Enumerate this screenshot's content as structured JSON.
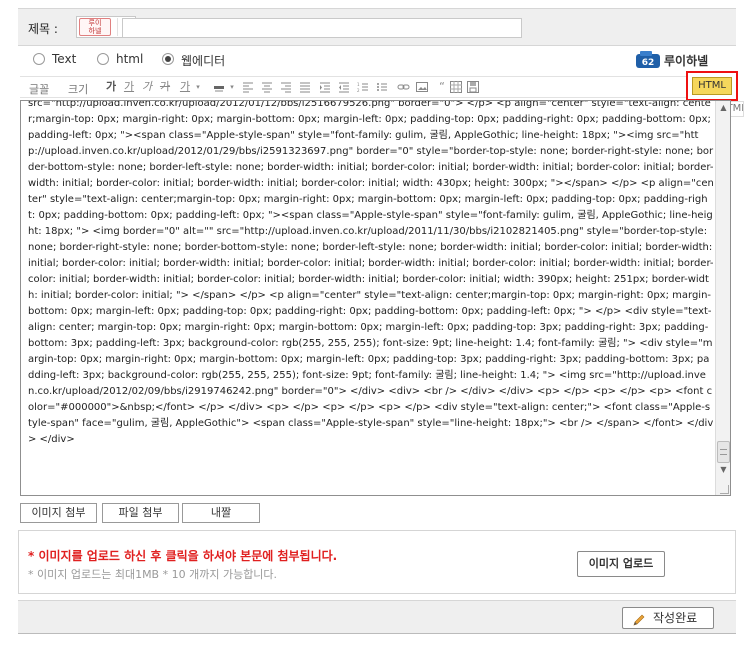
{
  "title_row": {
    "label": "제목 :",
    "emoticon_text": "루이\n하넬",
    "input_value": ""
  },
  "mode": {
    "options": [
      "Text",
      "html",
      "웹에디터"
    ],
    "selected": "웹에디터"
  },
  "site": {
    "badge_number": "62",
    "name": "루이하넬"
  },
  "toolbar": {
    "font_label": "글꼴",
    "size_label": "크기",
    "html_button": "HTML",
    "html_tooltip": "HTML",
    "icons": [
      "bold-icon",
      "underline-icon",
      "italic-icon",
      "strikethrough-icon",
      "text-color-icon",
      "background-color-icon",
      "align-left-icon",
      "align-center-icon",
      "align-right-icon",
      "align-justify-icon",
      "indent-icon",
      "outdent-icon",
      "ordered-list-icon",
      "unordered-list-icon",
      "link-icon",
      "image-icon",
      "quote-icon",
      "table-icon",
      "save-icon"
    ]
  },
  "editor": {
    "content": "src=\"http://upload.inven.co.kr/upload/2012/01/12/bbs/i2516679526.png\" border=\"0\"> </p> <p align=\"center\" style=\"text-align: center;margin-top: 0px; margin-right: 0px; margin-bottom: 0px; margin-left: 0px; padding-top: 0px; padding-right: 0px; padding-bottom: 0px; padding-left: 0px; \"><span class=\"Apple-style-span\" style=\"font-family: gulim, 굴림, AppleGothic; line-height: 18px; \"><img src=\"http://upload.inven.co.kr/upload/2012/01/29/bbs/i2591323697.png\" border=\"0\" style=\"border-top-style: none; border-right-style: none; border-bottom-style: none; border-left-style: none; border-width: initial; border-color: initial; border-width: initial; border-color: initial; border-width: initial; border-color: initial; border-width: initial; border-color: initial; width: 430px; height: 300px; \"></span> </p> <p align=\"center\" style=\"text-align: center;margin-top: 0px; margin-right: 0px; margin-bottom: 0px; margin-left: 0px; padding-top: 0px; padding-right: 0px; padding-bottom: 0px; padding-left: 0px; \"><span class=\"Apple-style-span\" style=\"font-family: gulim, 굴림, AppleGothic; line-height: 18px; \"> <img border=\"0\" alt=\"\" src=\"http://upload.inven.co.kr/upload/2011/11/30/bbs/i2102821405.png\" style=\"border-top-style: none; border-right-style: none; border-bottom-style: none; border-left-style: none; border-width: initial; border-color: initial; border-width: initial; border-color: initial; border-width: initial; border-color: initial; border-width: initial; border-color: initial; border-width: initial; border-color: initial; border-width: initial; border-color: initial; border-width: initial; border-color: initial; width: 390px; height: 251px; border-width: initial; border-color: initial; \"> </span> </p> <p align=\"center\" style=\"text-align: center;margin-top: 0px; margin-right: 0px; margin-bottom: 0px; margin-left: 0px; padding-top: 0px; padding-right: 0px; padding-bottom: 0px; padding-left: 0px; \"> </p> <div style=\"text-align: center; margin-top: 0px; margin-right: 0px; margin-bottom: 0px; margin-left: 0px; padding-top: 3px; padding-right: 3px; padding-bottom: 3px; padding-left: 3px; background-color: rgb(255, 255, 255); font-size: 9pt; line-height: 1.4; font-family: 굴림; \"> <div style=\"margin-top: 0px; margin-right: 0px; margin-bottom: 0px; margin-left: 0px; padding-top: 3px; padding-right: 3px; padding-bottom: 3px; padding-left: 3px; background-color: rgb(255, 255, 255); font-size: 9pt; font-family: 굴림; line-height: 1.4; \"> <img src=\"http://upload.inven.co.kr/upload/2012/02/09/bbs/i2919746242.png\" border=\"0\"> </div> <div> <br /> </div> </div> <p> </p> <p> </p> <p> <font color=\"#000000\">&nbsp;</font> </p> </div> <p> </p> <p> </p> <p> </p> <div style=\"text-align: center;\"> <font class=\"Apple-style-span\" face=\"gulim, 굴림, AppleGothic\"> <span class=\"Apple-style-span\" style=\"line-height: 18px;\"> <br /> </span> </font> </div> </div>"
  },
  "attachments": {
    "image_attach": "이미지 첨부",
    "file_attach": "파일 첨부",
    "scrap": "내짤"
  },
  "upload": {
    "notice": "* 이미지를 업로드 하신 후 클릭을 하셔야 본문에 첨부됩니다.",
    "limit": "* 이미지 업로드는 최대1MB * 10 개까지 가능합니다.",
    "button": "이미지 업로드"
  },
  "footer": {
    "submit": "작성완료"
  },
  "colors": {
    "highlight_border": "#ee1111",
    "html_button_bg": "#f5d75c",
    "notice_red": "#e02020"
  }
}
